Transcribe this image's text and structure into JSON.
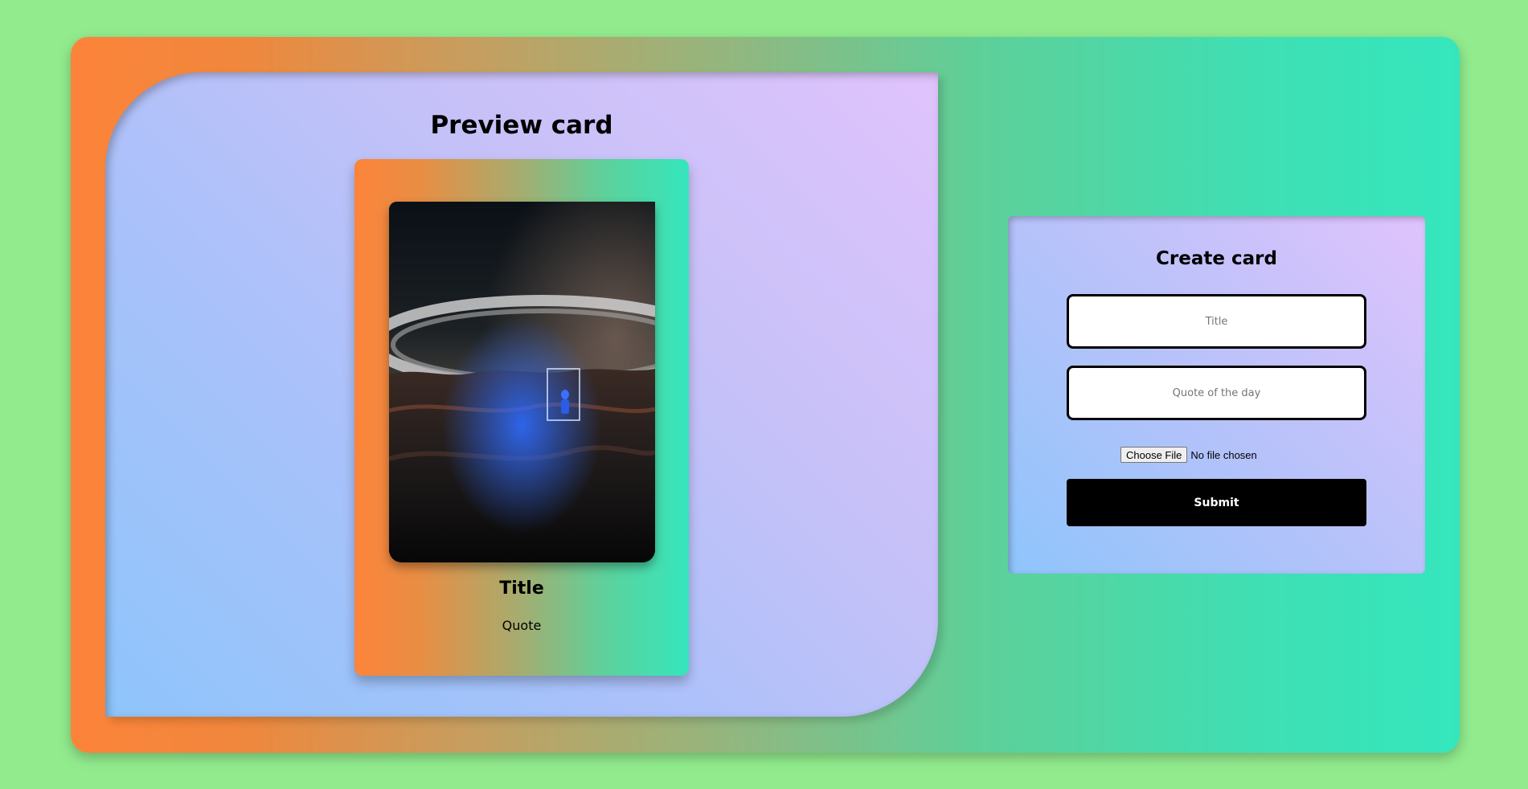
{
  "preview": {
    "heading": "Preview card",
    "card": {
      "title": "Title",
      "quote": "Quote",
      "image_icon": "astronaut-portal-planet-image"
    }
  },
  "form": {
    "heading": "Create card",
    "title_field": {
      "placeholder": "Title",
      "value": ""
    },
    "quote_field": {
      "placeholder": "Quote of the day",
      "value": ""
    },
    "file_input": {
      "button_label": "Choose File",
      "status": "No file chosen"
    },
    "submit_label": "Submit"
  },
  "colors": {
    "page_background": "#92ec8e",
    "gradient_orange": "#fc843a",
    "gradient_teal": "#35e6bd",
    "panel_blue": "#8ec5fb",
    "panel_lavender": "#e0c3fc",
    "submit_background": "#000000"
  }
}
